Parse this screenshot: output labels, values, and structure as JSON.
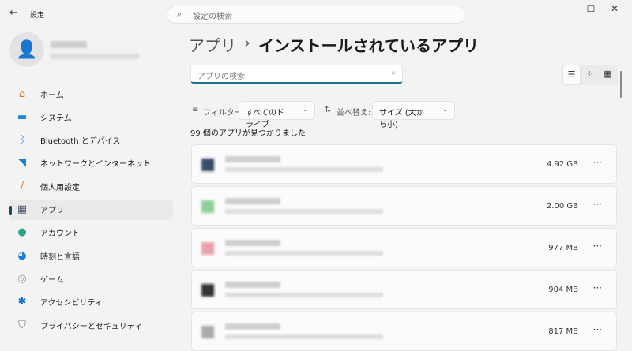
{
  "window": {
    "title": "設定",
    "search_placeholder": "設定の検索"
  },
  "sidebar": {
    "items": [
      {
        "label": "ホーム",
        "icon": "home-icon",
        "glyph": "⌂",
        "color": "#e07a2e"
      },
      {
        "label": "システム",
        "icon": "system-icon",
        "glyph": "▬",
        "color": "#1b8ad1"
      },
      {
        "label": "Bluetooth とデバイス",
        "icon": "bluetooth-icon",
        "glyph": "ᛒ",
        "color": "#1a6fd6"
      },
      {
        "label": "ネットワークとインターネット",
        "icon": "wifi-icon",
        "glyph": "◥",
        "color": "#1a7fd6"
      },
      {
        "label": "個人用設定",
        "icon": "brush-icon",
        "glyph": "/",
        "color": "#e07a2e"
      },
      {
        "label": "アプリ",
        "icon": "apps-icon",
        "glyph": "▦",
        "color": "#4a5a6a"
      },
      {
        "label": "アカウント",
        "icon": "account-icon",
        "glyph": "●",
        "color": "#2aa68a"
      },
      {
        "label": "時刻と言語",
        "icon": "time-language-icon",
        "glyph": "◕",
        "color": "#1a7fd6"
      },
      {
        "label": "ゲーム",
        "icon": "gaming-icon",
        "glyph": "◎",
        "color": "#8a9aa8"
      },
      {
        "label": "アクセシビリティ",
        "icon": "accessibility-icon",
        "glyph": "✱",
        "color": "#1a6fd6"
      },
      {
        "label": "プライバシーとセキュリティ",
        "icon": "shield-icon",
        "glyph": "⛉",
        "color": "#6a7580"
      }
    ],
    "active": 5
  },
  "header": {
    "crumb": "アプリ",
    "separator": "›",
    "title": "インストールされているアプリ"
  },
  "app_search": {
    "placeholder": "アプリの検索"
  },
  "filter": {
    "label": "フィルター:",
    "value": "すべてのドライブ"
  },
  "sort": {
    "label": "並べ替え:",
    "value": "サイズ (大から小)"
  },
  "count_text": "99 個のアプリが見つかりました",
  "apps": [
    {
      "size": "4.92 GB",
      "color": "#3a4a6a"
    },
    {
      "size": "2.00 GB",
      "color": "#8fd09a"
    },
    {
      "size": "977 MB",
      "color": "#e8a0a8"
    },
    {
      "size": "904 MB",
      "color": "#333"
    },
    {
      "size": "817 MB",
      "color": "#aaa"
    }
  ],
  "more": "···"
}
